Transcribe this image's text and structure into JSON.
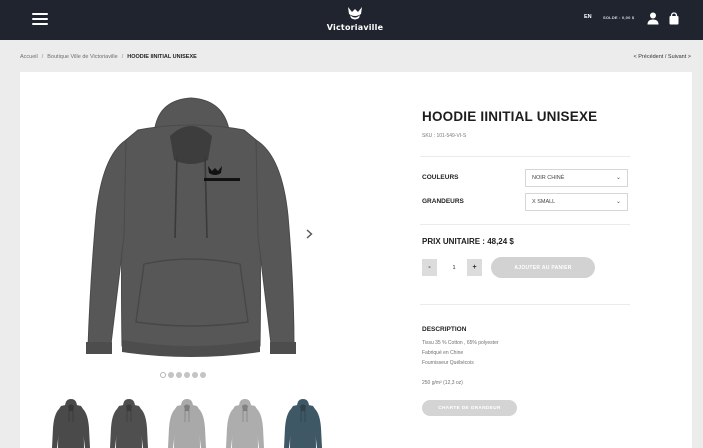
{
  "header": {
    "logo_text": "Victoriaville",
    "language": "EN",
    "balance": "SOLDE : 0,00 $",
    "icons": {
      "menu": "hamburger-menu-icon",
      "user": "user-icon",
      "cart": "cart-icon"
    }
  },
  "breadcrumb": {
    "items": [
      "Accueil",
      "Boutique Ville de Victoriaville",
      "HOODIE IINITIAL UNISEXE"
    ],
    "separator": "/",
    "prev_next": "< Précédent / Suivant >"
  },
  "gallery": {
    "dot_count": 6,
    "active_dot": 0,
    "thumbnail_colors": [
      "#4a4a4a",
      "#4f4f4f",
      "#a9a9a9",
      "#adadad",
      "#3e5866"
    ],
    "main_color": "#575757",
    "next_icon": "chevron-right-icon"
  },
  "product": {
    "title": "HOODIE IINITIAL UNISEXE",
    "sku": "SKU : 101-549-VI-S",
    "colors_label": "COULEURS",
    "colors_value": "NOIR CHINÉ",
    "sizes_label": "GRANDEURS",
    "sizes_value": "X SMALL",
    "price": "PRIX UNITAIRE : 48,24 $",
    "qty_minus": "-",
    "qty_value": "1",
    "qty_plus": "+",
    "add_to_cart": "AJOUTER AU PANIER"
  },
  "description": {
    "title": "DESCRIPTION",
    "lines": [
      "Tissu 35 % Cotton , 65% polyester",
      "Fabriqué en Chine",
      "Fournisseur Québécois"
    ],
    "weight": "250 g/m² (12,3 oz)",
    "size_chart_button": "CHARTE DE GRANDEUR"
  },
  "colors": {
    "header_bg": "#20242f",
    "page_bg": "#ececec",
    "disabled_button": "#d2d2d2"
  }
}
